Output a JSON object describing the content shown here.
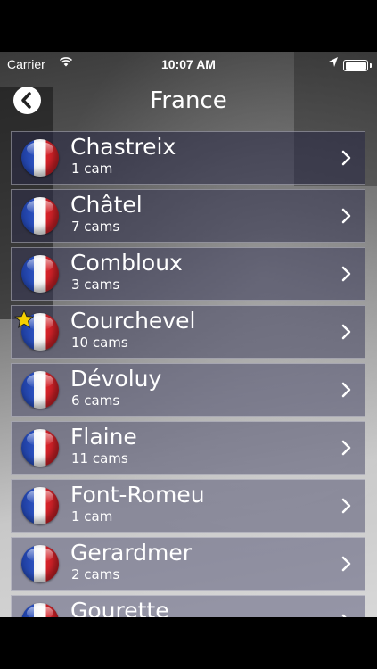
{
  "status_bar": {
    "carrier": "Carrier",
    "time": "10:07 AM"
  },
  "nav": {
    "title": "France",
    "back_icon": "back-arrow-icon"
  },
  "resorts": [
    {
      "name": "Chastreix",
      "cams": "1 cam",
      "favorite": false
    },
    {
      "name": "Châtel",
      "cams": "7 cams",
      "favorite": false
    },
    {
      "name": "Combloux",
      "cams": "3 cams",
      "favorite": false
    },
    {
      "name": "Courchevel",
      "cams": "10 cams",
      "favorite": true
    },
    {
      "name": "Dévoluy",
      "cams": "6 cams",
      "favorite": false
    },
    {
      "name": "Flaine",
      "cams": "11 cams",
      "favorite": false
    },
    {
      "name": "Font-Romeu",
      "cams": "1 cam",
      "favorite": false
    },
    {
      "name": "Gerardmer",
      "cams": "2 cams",
      "favorite": false
    },
    {
      "name": "Gourette",
      "cams": "",
      "favorite": false
    }
  ],
  "colors": {
    "star": "#f5d000",
    "flag_blue": "#2a4fbd",
    "flag_red": "#d8232a"
  },
  "icons": {
    "flag": "france-flag-icon",
    "favorite": "star-icon",
    "chevron": "chevron-right-icon"
  }
}
